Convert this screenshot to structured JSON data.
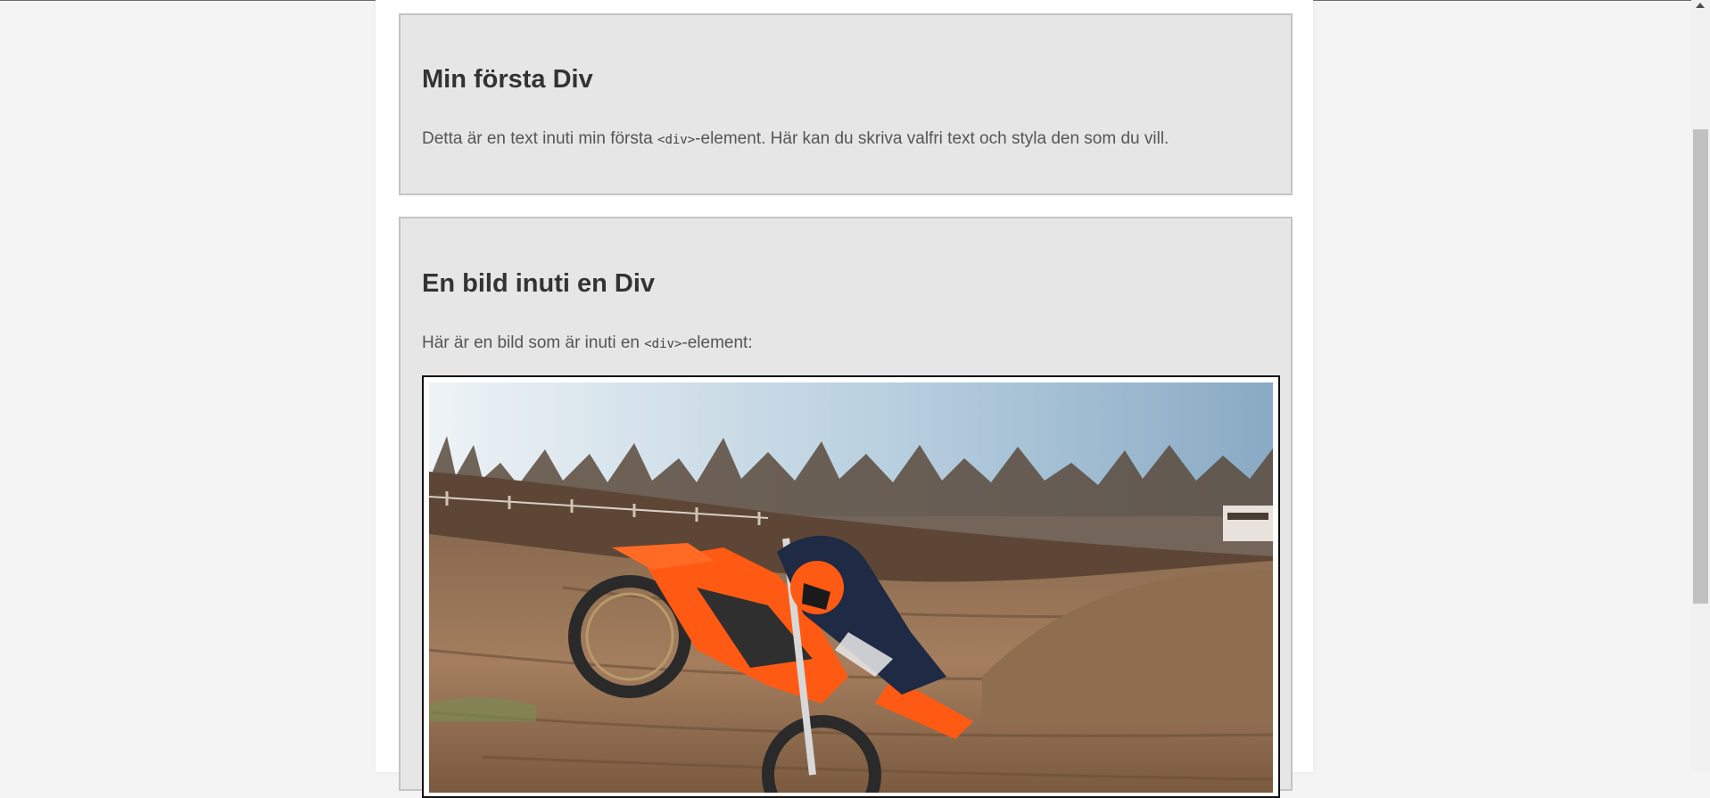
{
  "section1": {
    "heading": "Min första Div",
    "text_before": "Detta är en text inuti min första ",
    "code": "<div>",
    "text_after": "-element. Här kan du skriva valfri text och styla den som du vill."
  },
  "section2": {
    "heading": "En bild inuti en Div",
    "text_before": "Här är en bild som är inuti en ",
    "code": "<div>",
    "text_after": "-element:",
    "image": "motocross-rider-photo"
  },
  "colors": {
    "page_background": "#f4f4f4",
    "box_background": "#e6e6e6",
    "heading": "#333333",
    "motorcycle": "#ff5a14"
  }
}
